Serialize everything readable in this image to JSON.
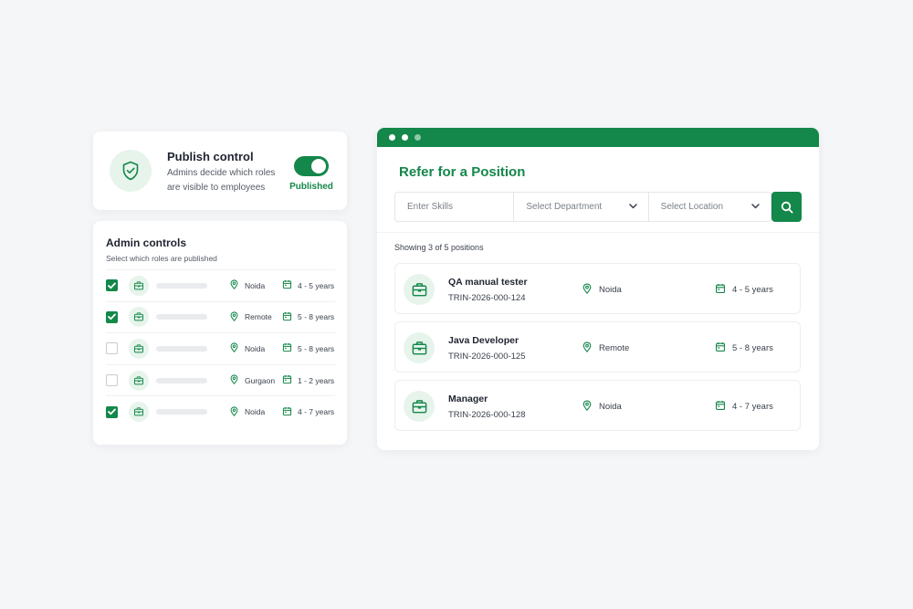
{
  "colors": {
    "brand": "#14874a",
    "brand_light": "#e7f4ec",
    "background": "#f5f6f8"
  },
  "publish": {
    "icon": "shield-check-icon",
    "title": "Publish control",
    "description": "Admins decide which roles are visible to employees",
    "toggle_on": true,
    "status_label": "Published"
  },
  "admin": {
    "title": "Admin controls",
    "subtitle": "Select which roles are published",
    "rows": [
      {
        "checked": true,
        "location": "Noida",
        "experience": "4 - 5 years"
      },
      {
        "checked": true,
        "location": "Remote",
        "experience": "5 - 8 years"
      },
      {
        "checked": false,
        "location": "Noida",
        "experience": "5 - 8 years"
      },
      {
        "checked": false,
        "location": "Gurgaon",
        "experience": "1 - 2 years"
      },
      {
        "checked": true,
        "location": "Noida",
        "experience": "4 - 7 years"
      }
    ]
  },
  "referral": {
    "title": "Refer for a Position",
    "search": {
      "skills_placeholder": "Enter Skills",
      "department_placeholder": "Select Department",
      "location_placeholder": "Select Location"
    },
    "showing": "Showing 3 of 5 positions",
    "positions": [
      {
        "title": "QA manual tester",
        "id": "TRIN-2026-000-124",
        "location": "Noida",
        "experience": "4 - 5 years"
      },
      {
        "title": "Java Developer",
        "id": "TRIN-2026-000-125",
        "location": "Remote",
        "experience": "5 - 8 years"
      },
      {
        "title": "Manager",
        "id": "TRIN-2026-000-128",
        "location": "Noida",
        "experience": "4 - 7 years"
      }
    ]
  }
}
